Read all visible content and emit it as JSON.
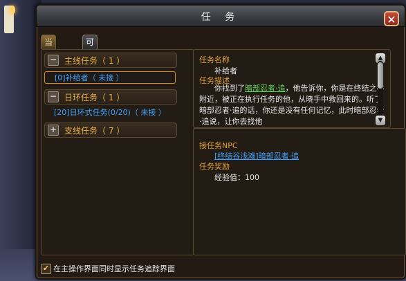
{
  "window": {
    "title": "任 务",
    "close_icon": "close-icon"
  },
  "tabs": [
    {
      "label": "当前任务",
      "active": false
    },
    {
      "label": "可接任务",
      "active": true
    }
  ],
  "quest_groups": {
    "main": {
      "label": "主线任务（ 1 ）",
      "icon": "−"
    },
    "main_items": [
      {
        "text": "[0]补给者（ 未接 ）"
      }
    ],
    "daily": {
      "label": "日环任务（ 1 ）",
      "icon": "−"
    },
    "daily_items": [
      {
        "text": "[20]日环式任务(0/20)（ 未接 ）"
      }
    ],
    "side": {
      "label": "支线任务（ 7 ）",
      "icon": "+"
    }
  },
  "detail": {
    "name_label": "任务名称",
    "name_value": "补给者",
    "desc_label": "任务描述",
    "desc_prefix": "你找到了",
    "desc_link": "暗部忍者·追",
    "desc_rest": "，他告诉你，你是在终结之谷附近，被正在执行任务的他，从晓手中救回来的。听了暗部忍者·追的话，你还是没有任何记忆，此时暗部忍者·追说，让你去找他",
    "npc_label": "接任务NPC",
    "npc_value": "[终结谷浅滩]暗部忍者·追",
    "reward_label": "任务奖励",
    "reward_value": "经验值：100"
  },
  "scrollbar": {
    "up": "▲",
    "down": "▼"
  },
  "footer": {
    "checkbox_checked": true,
    "checkbox_mark": "✔",
    "checkbox_label": "在主操作界面同时显示任务追踪界面"
  }
}
